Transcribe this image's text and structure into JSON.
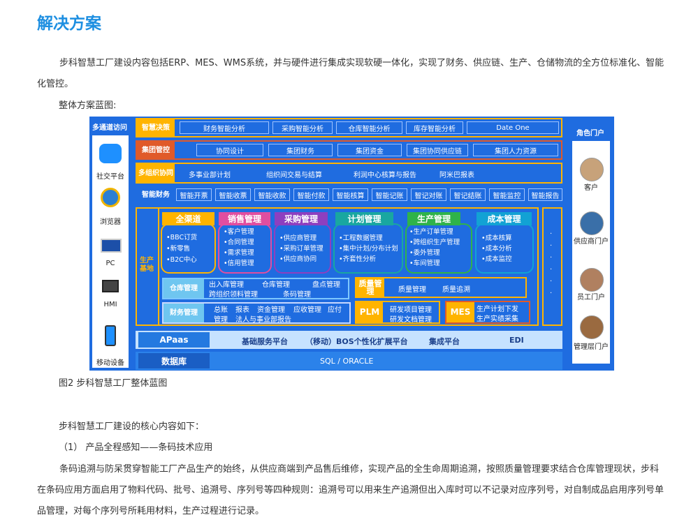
{
  "heading": "解决方案",
  "intro": "步科智慧工厂建设内容包括ERP、MES、WMS系统，并与硬件进行集成实现软硬一体化，实现了财务、供应链、生产、仓储物流的全方位标准化、智能化管控。",
  "blueprint_label": "整体方案蓝图:",
  "caption": "图2  步科智慧工厂整体蓝图",
  "core_intro": "步科智慧工厂建设的核心内容如下：",
  "item1_title": "（1）  产品全程感知——条码技术应用",
  "item1_body": "条码追溯与防呆贯穿智能工厂产品生产的始终，从供应商端到产品售后维修，实现产品的全生命周期追溯，按照质量管理要求结合仓库管理现状，步科在条码应用方面启用了物料代码、批号、追溯号、序列号等四种规则：追溯号可以用来生产追溯但出入库时可以不记录对应序列号，对自制成品启用序列号单品管理，对每个序列号所耗用材料，生产过程进行记录。",
  "diagram": {
    "left_title": "多通道访问",
    "channels": [
      "社交平台",
      "浏览器",
      "PC",
      "HMI",
      "移动设备"
    ],
    "right_title": "角色门户",
    "roles": [
      "客户",
      "供应商门户",
      "员工门户",
      "管理层门户"
    ],
    "row1": {
      "label": "智慧决策",
      "items": [
        "财务智能分析",
        "采购智能分析",
        "仓库智能分析",
        "库存智能分析",
        "Date One"
      ]
    },
    "row2": {
      "label": "集团管控",
      "items": [
        "协同设计",
        "集团财务",
        "集团资金",
        "集团协同供应链",
        "集团人力资源"
      ]
    },
    "row3": {
      "label": "多组织协同",
      "items": [
        "多事业部计划",
        "组织间交易与结算",
        "利润中心核算与报告",
        "阿米巴报表"
      ]
    },
    "row4": {
      "label": "智能财务",
      "items": [
        "智能开票",
        "智能收票",
        "智能收款",
        "智能付款",
        "智能核算",
        "智能记账",
        "智记对账",
        "智记结账",
        "智能监控",
        "智能报告"
      ]
    },
    "prod_label": "生产基地",
    "modules": [
      {
        "title": "全渠道",
        "items": [
          "•BBC订货",
          "•新零售",
          "•B2C中心"
        ]
      },
      {
        "title": "销售管理",
        "items": [
          "•客户管理",
          "•合同管理",
          "•需求管理",
          "•信用管理"
        ]
      },
      {
        "title": "采购管理",
        "items": [
          "•供应商管理",
          "•采购订单管理",
          "•供应商协同"
        ]
      },
      {
        "title": "计划管理",
        "items": [
          "•工程数据管理",
          "•集中计划/分布计划",
          "•齐套性分析"
        ]
      },
      {
        "title": "生产管理",
        "items": [
          "•生产订单管理",
          "•跨组织生产管理",
          "•委外管理",
          "•车间管理"
        ]
      },
      {
        "title": "成本管理",
        "items": [
          "•成本核算",
          "•成本分析",
          "•成本监控"
        ]
      }
    ],
    "warehouse": {
      "label": "仓库管理",
      "items": [
        "出入库管理",
        "仓库管理",
        "盘点管理",
        "跨组织领料管理",
        "条码管理"
      ]
    },
    "quality": {
      "label": "质量管理",
      "items": [
        "质量管理",
        "质量追溯"
      ]
    },
    "finance": {
      "label": "财务管理",
      "items": [
        "总账",
        "报表",
        "资金管理",
        "应收管理",
        "应付",
        "管理",
        "法人与事业部报告"
      ]
    },
    "plm": {
      "label": "PLM",
      "items": [
        "研发项目管理",
        "研发文档管理"
      ]
    },
    "mes": {
      "label": "MES",
      "items": [
        "生产计划下发",
        "生产实绩采集"
      ]
    },
    "apaas": {
      "label": "APaas",
      "items": [
        "基础服务平台",
        "（移动）BOS个性化扩展平台",
        "集成平台",
        "EDI"
      ]
    },
    "db": {
      "label": "数据库",
      "value": "SQL / ORACLE"
    }
  }
}
